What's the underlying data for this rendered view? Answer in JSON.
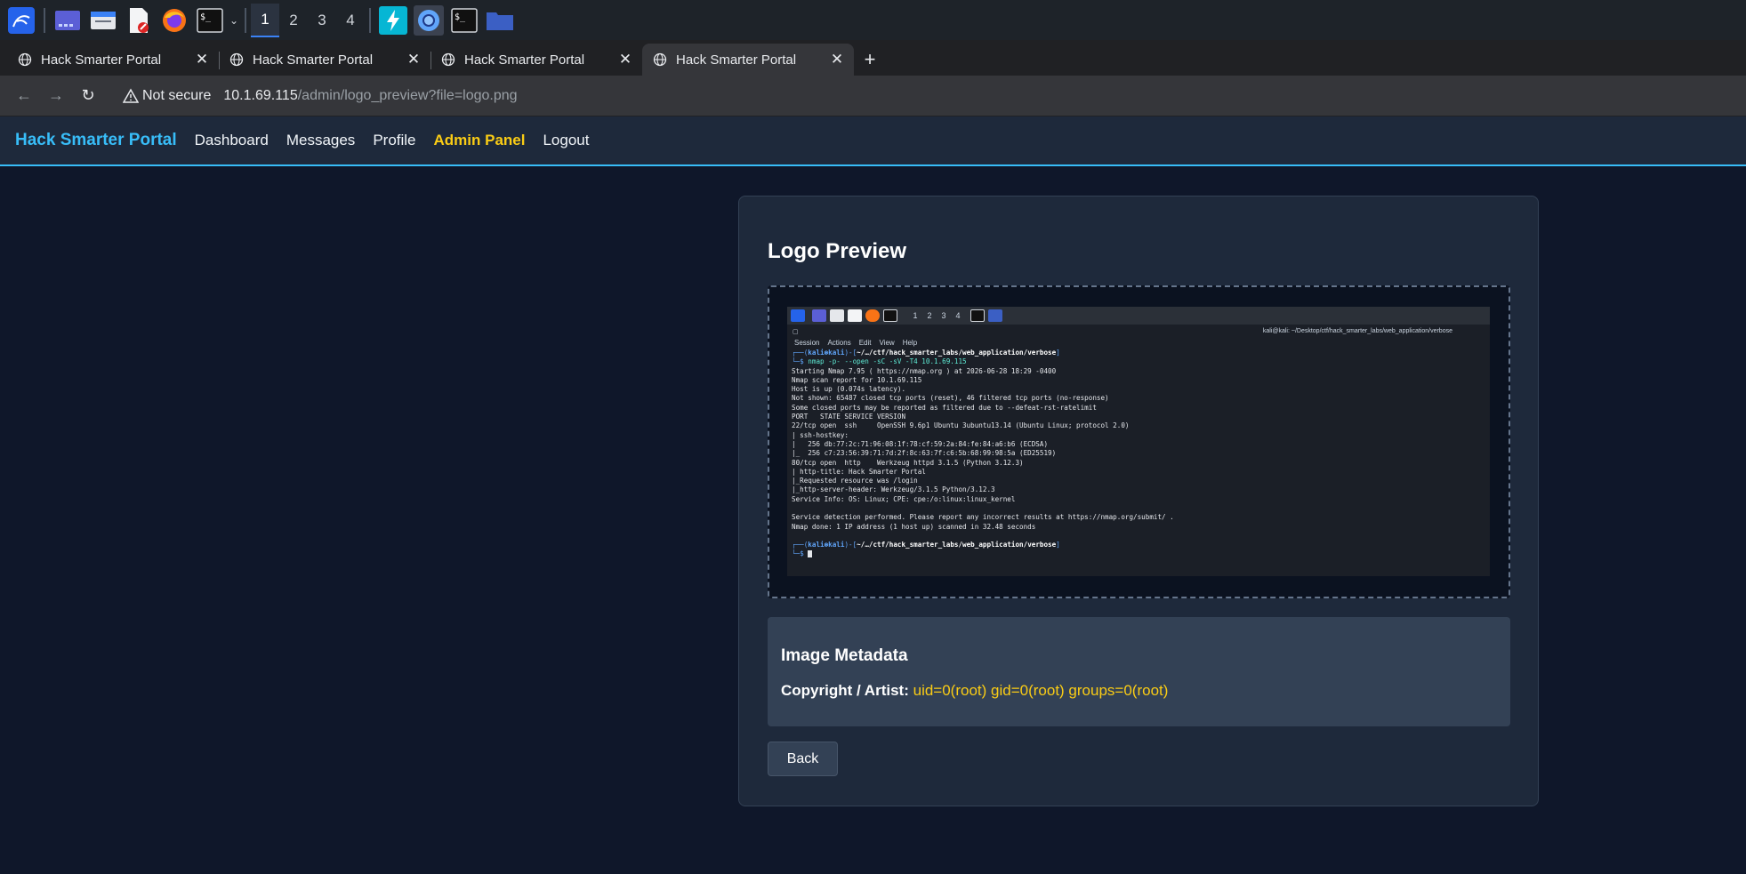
{
  "taskbar": {
    "workspaces": [
      "1",
      "2",
      "3",
      "4"
    ],
    "active_workspace": "1",
    "icons": [
      "kali-menu-icon",
      "workspace-switcher-icon",
      "file-manager-icon",
      "text-editor-icon",
      "firefox-icon",
      "terminal-icon",
      "chevron-down-icon",
      "burp-icon",
      "chromium-icon",
      "terminal-icon",
      "folder-icon"
    ]
  },
  "browser": {
    "tabs": [
      {
        "title": "Hack Smarter Portal"
      },
      {
        "title": "Hack Smarter Portal"
      },
      {
        "title": "Hack Smarter Portal"
      },
      {
        "title": "Hack Smarter Portal"
      }
    ],
    "active_tab": 3,
    "security_label": "Not secure",
    "url_host": "10.1.69.115",
    "url_path": "/admin/logo_preview?file=logo.png"
  },
  "site": {
    "brand": "Hack Smarter Portal",
    "nav": {
      "dashboard": "Dashboard",
      "messages": "Messages",
      "profile": "Profile",
      "admin": "Admin Panel",
      "logout": "Logout"
    }
  },
  "preview": {
    "heading": "Logo Preview",
    "shot": {
      "workspaces": [
        "1",
        "2",
        "3",
        "4"
      ],
      "window_title": "kali@kali: ~/Desktop/ctf/hack_smarter_labs/web_application/verbose",
      "menu": [
        "Session",
        "Actions",
        "Edit",
        "View",
        "Help"
      ],
      "prompt_user": "kali⊛kali",
      "prompt_path": "~/…/ctf/hack_smarter_labs/web_application/verbose",
      "command": "nmap -p- --open -sC -sV -T4 10.1.69.115",
      "output": [
        "Starting Nmap 7.95 ( https://nmap.org ) at 2026-06-28 18:29 -0400",
        "Nmap scan report for 10.1.69.115",
        "Host is up (0.074s latency).",
        "Not shown: 65487 closed tcp ports (reset), 46 filtered tcp ports (no-response)",
        "Some closed ports may be reported as filtered due to --defeat-rst-ratelimit",
        "PORT   STATE SERVICE VERSION",
        "22/tcp open  ssh     OpenSSH 9.6p1 Ubuntu 3ubuntu13.14 (Ubuntu Linux; protocol 2.0)",
        "| ssh-hostkey:",
        "|   256 db:77:2c:71:96:08:1f:78:cf:59:2a:84:fe:84:a6:b6 (ECDSA)",
        "|_  256 c7:23:56:39:71:7d:2f:8c:63:7f:c6:5b:68:99:98:5a (ED25519)",
        "80/tcp open  http    Werkzeug httpd 3.1.5 (Python 3.12.3)",
        "| http-title: Hack Smarter Portal",
        "|_Requested resource was /login",
        "|_http-server-header: Werkzeug/3.1.5 Python/3.12.3",
        "Service Info: OS: Linux; CPE: cpe:/o:linux:linux_kernel",
        "",
        "Service detection performed. Please report any incorrect results at https://nmap.org/submit/ .",
        "Nmap done: 1 IP address (1 host up) scanned in 32.48 seconds"
      ]
    }
  },
  "metadata": {
    "heading": "Image Metadata",
    "label": "Copyright / Artist:",
    "value": "uid=0(root) gid=0(root) groups=0(root)"
  },
  "back_label": "Back",
  "colors": {
    "accent": "#38bdf8",
    "highlight": "#facc15",
    "page_bg": "#0f172a",
    "card_bg": "#1e293b"
  }
}
